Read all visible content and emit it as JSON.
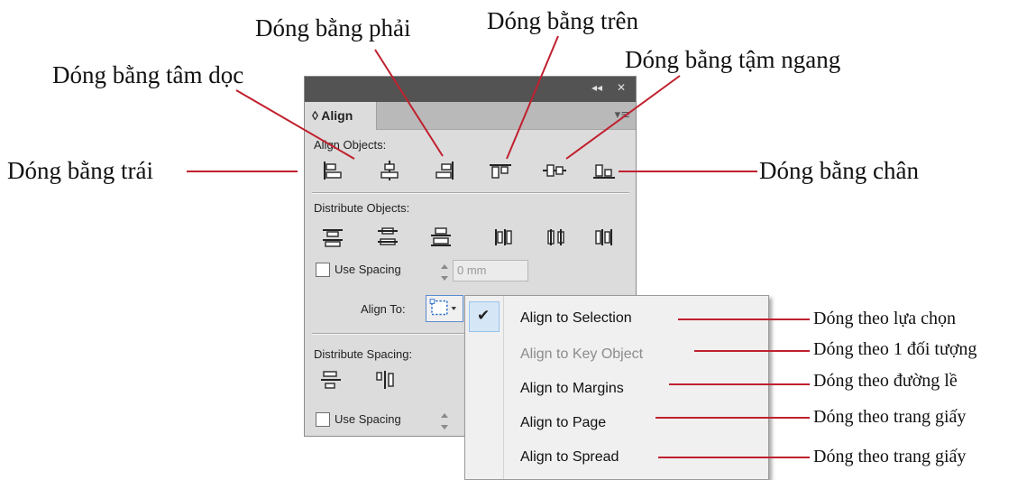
{
  "callouts": {
    "top_center": "Dóng bằng phải",
    "left_center": "Dóng bằng tâm dọc",
    "left": "Dóng bằng trái",
    "top_right": "Dóng bằng trên",
    "center_h": "Dóng bằng tậm ngang",
    "bottom": "Dóng bằng chân"
  },
  "panel": {
    "tab_label": "◊ Align",
    "collapse_glyph": "◂◂",
    "close_glyph": "✕",
    "menu_glyph": "▾≡",
    "align_objects_label": "Align Objects:",
    "distribute_objects_label": "Distribute Objects:",
    "use_spacing_label": "Use Spacing",
    "spacing_value": "0 mm",
    "align_to_label": "Align To:",
    "distribute_spacing_label": "Distribute Spacing:",
    "use_spacing_label_2": "Use Spacing"
  },
  "dropdown": {
    "check_glyph": "✔",
    "items": [
      {
        "label": "Align to Selection",
        "enabled": true,
        "checked": true
      },
      {
        "label": "Align to Key Object",
        "enabled": false,
        "checked": false
      },
      {
        "label": "Align to Margins",
        "enabled": true,
        "checked": false
      },
      {
        "label": "Align to Page",
        "enabled": true,
        "checked": false
      },
      {
        "label": "Align to Spread",
        "enabled": true,
        "checked": false
      }
    ]
  },
  "dropdown_callouts": [
    "Dóng theo lựa chọn",
    "Dóng theo 1 đối tượng",
    "Dóng theo đường lề",
    "Dóng theo trang giấy",
    "Dóng theo trang giấy"
  ],
  "colors": {
    "leader_line": "#c0202e",
    "panel_bg": "#dcdcdc",
    "titlebar": "#535353",
    "selection_highlight": "#d5e6f6"
  }
}
